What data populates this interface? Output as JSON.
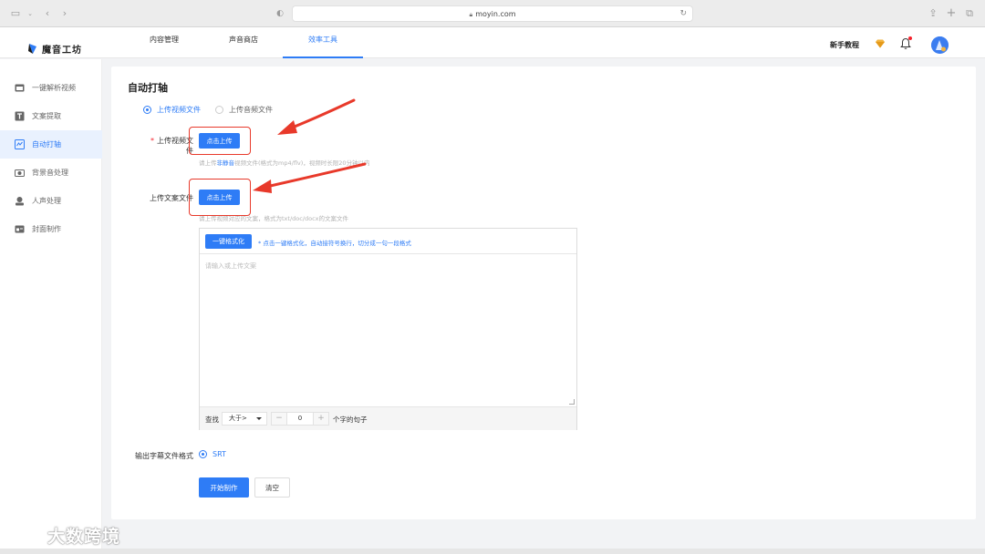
{
  "browser": {
    "url": "moyin.com"
  },
  "brand": {
    "name": "魔音工坊",
    "accent": "#2e7cf6"
  },
  "topnav": {
    "tabs": [
      {
        "label": "内容管理"
      },
      {
        "label": "声音商店"
      },
      {
        "label": "效率工具",
        "active": true
      }
    ],
    "tutorial_label": "新手教程",
    "icons": [
      "diamond-icon",
      "bell-icon",
      "avatar"
    ]
  },
  "sidebar": {
    "items": [
      {
        "label": "一键解析视频",
        "icon": "video-parse-icon"
      },
      {
        "label": "文案提取",
        "icon": "text-extract-icon"
      },
      {
        "label": "自动打轴",
        "icon": "auto-timeline-icon",
        "active": true
      },
      {
        "label": "背景音处理",
        "icon": "bg-audio-icon"
      },
      {
        "label": "人声处理",
        "icon": "voice-icon"
      },
      {
        "label": "封面制作",
        "icon": "cover-icon"
      }
    ]
  },
  "main": {
    "title": "自动打轴",
    "upload_type": {
      "options": [
        {
          "label": "上传视频文件",
          "checked": true
        },
        {
          "label": "上传音频文件",
          "checked": false
        }
      ]
    },
    "video_upload": {
      "required_mark": "*",
      "label": "上传视频文件",
      "button": "点击上传",
      "hint_prefix": "请上传",
      "hint_highlight": "非静音",
      "hint_suffix": "视频文件(格式为mp4/flv)，视频时长限20分钟以内"
    },
    "script_upload": {
      "label": "上传文案文件",
      "button": "点击上传",
      "hint": "请上传视频对应的文案，格式为txt/doc/docx的文案文件"
    },
    "editor": {
      "format_button": "一键格式化",
      "format_hint": "* 点击一键格式化，自动接符号换行，切分成一句一段格式",
      "placeholder": "请输入或上传文案",
      "find_label": "查找",
      "select_value": "大于>",
      "stepper_minus": "−",
      "stepper_value": "0",
      "stepper_plus": "+",
      "unit_label": "个字的句子"
    },
    "output_format": {
      "label": "输出字幕文件格式",
      "option": "SRT",
      "checked": true
    },
    "actions": {
      "start_button": "开始制作",
      "clear_button": "清空"
    }
  },
  "watermark": {
    "text": "大数跨境"
  },
  "colors": {
    "annotation_red": "#e8392a",
    "primary": "#2e7cf6"
  }
}
